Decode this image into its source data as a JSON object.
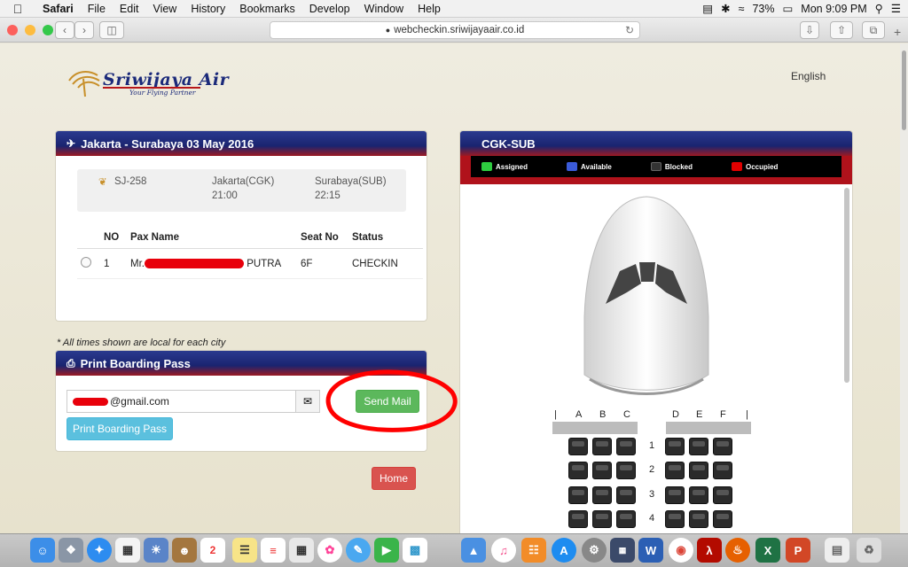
{
  "menubar": {
    "app": "Safari",
    "items": [
      "File",
      "Edit",
      "View",
      "History",
      "Bookmarks",
      "Develop",
      "Window",
      "Help"
    ],
    "battery": "73%",
    "clock": "Mon 9:09 PM"
  },
  "browser": {
    "url": "webcheckin.sriwijayaair.co.id"
  },
  "header": {
    "logo_name": "Sriwijaya Air",
    "logo_tagline": "Your Flying Partner",
    "language": "English"
  },
  "flight_panel": {
    "title": "Jakarta - Surabaya 03 May 2016",
    "flight_no": "SJ-258",
    "origin": "Jakarta(CGK)",
    "depart_time": "21:00",
    "destination": "Surabaya(SUB)",
    "arrive_time": "22:15",
    "columns": [
      "NO",
      "Pax Name",
      "Seat No",
      "Status"
    ],
    "rows": [
      {
        "no": "1",
        "name_prefix": "Mr.",
        "name_suffix": "PUTRA",
        "seat": "6F",
        "status": "CHECKIN"
      }
    ]
  },
  "note": "* All times shown are local for each city",
  "boarding_panel": {
    "title": "Print Boarding Pass",
    "email_value": "@gmail.com",
    "send_label": "Send Mail",
    "print_label": "Print Boarding Pass"
  },
  "home_label": "Home",
  "seat_panel": {
    "title": "CGK-SUB",
    "legend": [
      {
        "label": "Assigned",
        "color": "#2ecc40"
      },
      {
        "label": "Available",
        "color": "#3b5bd9"
      },
      {
        "label": "Blocked",
        "color": "#222222"
      },
      {
        "label": "Occupied",
        "color": "#e00000"
      }
    ],
    "left_columns": [
      "A",
      "B",
      "C"
    ],
    "right_columns": [
      "D",
      "E",
      "F"
    ],
    "rows": [
      "1",
      "2",
      "3",
      "4"
    ]
  },
  "colors": {
    "header_blue": "#1a2470",
    "header_red": "#9c1a22",
    "annotation_red": "#ff0000"
  }
}
